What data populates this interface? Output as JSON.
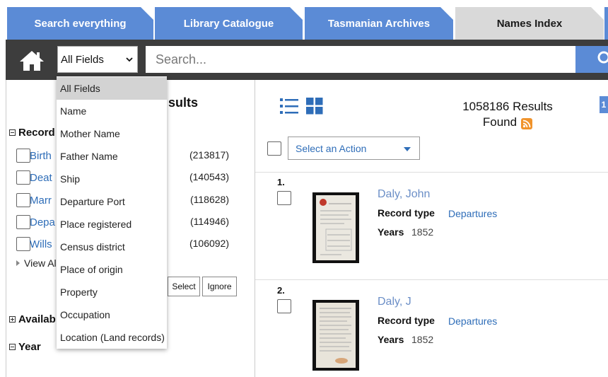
{
  "tabs": [
    {
      "label": "Search everything"
    },
    {
      "label": "Library Catalogue"
    },
    {
      "label": "Tasmanian Archives"
    },
    {
      "label": "Names Index"
    }
  ],
  "search": {
    "field_selected": "All Fields",
    "placeholder": "Search...",
    "value": ""
  },
  "dropdown": {
    "options": [
      "All Fields",
      "Name",
      "Mother Name",
      "Father Name",
      "Ship",
      "Departure Port",
      "Place registered",
      "Census district",
      "Place of origin",
      "Property",
      "Occupation",
      "Location (Land records)"
    ]
  },
  "left": {
    "results_heading_partial": "sults",
    "record_section_partial": "Record",
    "facets": [
      {
        "label": "Birth",
        "count": "(213817)"
      },
      {
        "label": "Deat",
        "count": "(140543)"
      },
      {
        "label": "Marr",
        "count": "(118628)"
      },
      {
        "label": "Depa",
        "count": "(114946)"
      },
      {
        "label": "Wills",
        "count": "(106092)"
      }
    ],
    "view_all_partial": "View Al",
    "select_label": "Select",
    "ignore_label": "Ignore",
    "available_partial": "Availab",
    "year_label": "Year"
  },
  "results": {
    "count_line1": "1058186 Results",
    "count_line2": "Found",
    "action_placeholder": "Select an Action",
    "page_badge": "1",
    "records": [
      {
        "num": "1.",
        "title": "Daly, John",
        "record_type_label": "Record type",
        "record_type": "Departures",
        "years_label": "Years",
        "years": "1852"
      },
      {
        "num": "2.",
        "title": "Daly, J",
        "record_type_label": "Record type",
        "record_type": "Departures",
        "years_label": "Years",
        "years": "1852"
      }
    ]
  },
  "colors": {
    "tab_blue": "#5b8bd6",
    "bar_dark": "#3d3d3d",
    "link_blue": "#2e6db8",
    "rss_orange": "#f0932b"
  }
}
